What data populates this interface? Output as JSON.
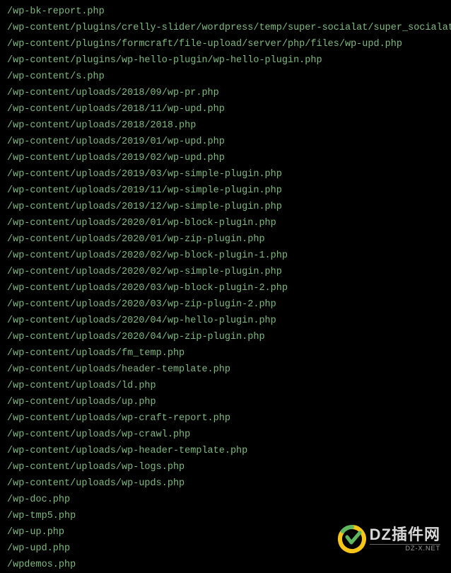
{
  "files": [
    "/wp-bk-report.php",
    "/wp-content/plugins/crelly-slider/wordpress/temp/super-socialat/super_socialat.php",
    "/wp-content/plugins/formcraft/file-upload/server/php/files/wp-upd.php",
    "/wp-content/plugins/wp-hello-plugin/wp-hello-plugin.php",
    "/wp-content/s.php",
    "/wp-content/uploads/2018/09/wp-pr.php",
    "/wp-content/uploads/2018/11/wp-upd.php",
    "/wp-content/uploads/2018/2018.php",
    "/wp-content/uploads/2019/01/wp-upd.php",
    "/wp-content/uploads/2019/02/wp-upd.php",
    "/wp-content/uploads/2019/03/wp-simple-plugin.php",
    "/wp-content/uploads/2019/11/wp-simple-plugin.php",
    "/wp-content/uploads/2019/12/wp-simple-plugin.php",
    "/wp-content/uploads/2020/01/wp-block-plugin.php",
    "/wp-content/uploads/2020/01/wp-zip-plugin.php",
    "/wp-content/uploads/2020/02/wp-block-plugin-1.php",
    "/wp-content/uploads/2020/02/wp-simple-plugin.php",
    "/wp-content/uploads/2020/03/wp-block-plugin-2.php",
    "/wp-content/uploads/2020/03/wp-zip-plugin-2.php",
    "/wp-content/uploads/2020/04/wp-hello-plugin.php",
    "/wp-content/uploads/2020/04/wp-zip-plugin.php",
    "/wp-content/uploads/fm_temp.php",
    "/wp-content/uploads/header-template.php",
    "/wp-content/uploads/ld.php",
    "/wp-content/uploads/up.php",
    "/wp-content/uploads/wp-craft-report.php",
    "/wp-content/uploads/wp-crawl.php",
    "/wp-content/uploads/wp-header-template.php",
    "/wp-content/uploads/wp-logs.php",
    "/wp-content/uploads/wp-upds.php",
    "/wp-doc.php",
    "/wp-tmp5.php",
    "/wp-up.php",
    "/wp-upd.php",
    "/wpdemos.php"
  ],
  "watermark": {
    "main": "DZ插件网",
    "sub": "DZ-X.NET"
  }
}
